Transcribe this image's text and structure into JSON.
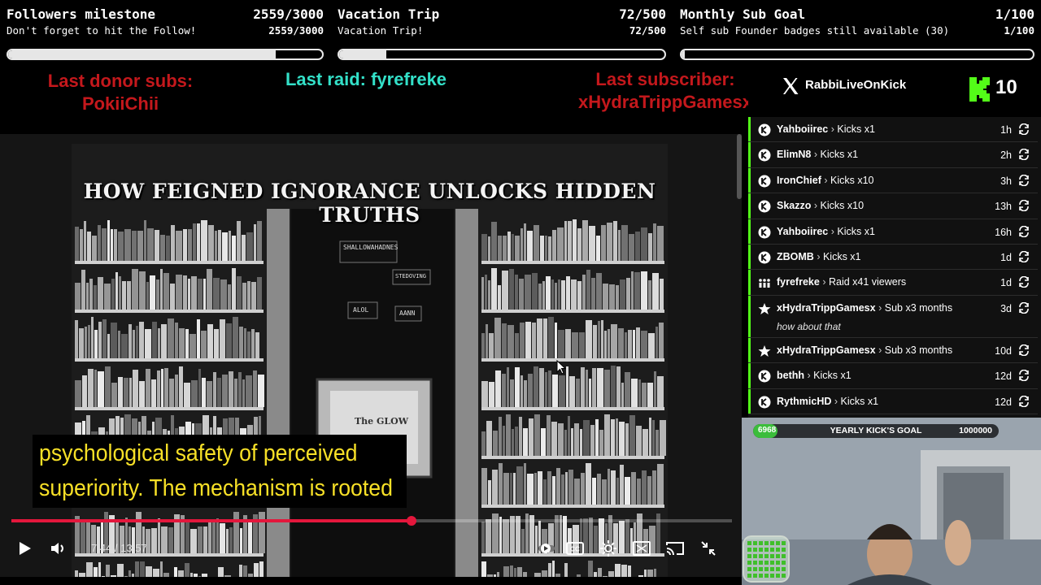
{
  "goals": [
    {
      "title": "Followers milestone",
      "count": "2559/3000",
      "subtitle": "Don't forget to hit the Follow!",
      "subcount": "2559/3000",
      "progress": 0.853
    },
    {
      "title": "Vacation Trip",
      "count": "72/500",
      "subtitle": "Vacation Trip!",
      "subcount": "72/500",
      "progress": 0.144
    },
    {
      "title": "Monthly Sub Goal",
      "count": "1/100",
      "subtitle": "Self sub Founder badges still available (30)",
      "subcount": "1/100",
      "progress": 0.01
    }
  ],
  "last_events": {
    "donor_label": "Last donor subs:",
    "donor_name": "PokiiChii",
    "raid": "Last raid: fyrefreke",
    "sub_label": "Last subscriber:",
    "sub_name": "xHydraTrippGamesx"
  },
  "kick_header": {
    "x_handle": "RabbiLiveOnKick",
    "kick_count": "10",
    "brand_color": "#53fc18"
  },
  "video": {
    "title_text": "HOW FEIGNED IGNORANCE UNLOCKS HIDDEN TRUTHS",
    "poster_labels": [
      "SHALLOWAHADNES",
      "STEDOVING",
      "ALOL",
      "AANN",
      "The GLOW"
    ],
    "caption_lines": [
      "psychological safety of perceived",
      "superiority. The mechanism is rooted"
    ],
    "time": "7:44 / 13:57",
    "progress_fraction": 0.555,
    "accent_color": "#e3173c",
    "caption_color": "#f7e027"
  },
  "events_list": [
    {
      "icon": "kick-icon",
      "user": "Yahboiirec",
      "action": "Kicks x1",
      "age": "1h"
    },
    {
      "icon": "kick-icon",
      "user": "ElimN8",
      "action": "Kicks x1",
      "age": "2h"
    },
    {
      "icon": "kick-icon",
      "user": "IronChief",
      "action": "Kicks x10",
      "age": "3h"
    },
    {
      "icon": "kick-icon",
      "user": "Skazzo",
      "action": "Kicks x10",
      "age": "13h"
    },
    {
      "icon": "kick-icon",
      "user": "Yahboiirec",
      "action": "Kicks x1",
      "age": "16h"
    },
    {
      "icon": "kick-icon",
      "user": "ZBOMB",
      "action": "Kicks x1",
      "age": "1d"
    },
    {
      "icon": "raid-icon",
      "user": "fyrefreke",
      "action": "Raid x41 viewers",
      "age": "1d"
    },
    {
      "icon": "star-icon",
      "user": "xHydraTrippGamesx",
      "action": "Sub x3 months",
      "age": "3d",
      "note": "how about that"
    },
    {
      "icon": "star-icon",
      "user": "xHydraTrippGamesx",
      "action": "Sub x3 months",
      "age": "10d"
    },
    {
      "icon": "kick-icon",
      "user": "bethh",
      "action": "Kicks x1",
      "age": "12d"
    },
    {
      "icon": "kick-icon",
      "user": "RythmicHD",
      "action": "Kicks x1",
      "age": "12d"
    }
  ],
  "yearly_goal": {
    "current": "6968",
    "label": "YEARLY KICK'S GOAL",
    "target": "1000000",
    "progress": 0.007
  }
}
